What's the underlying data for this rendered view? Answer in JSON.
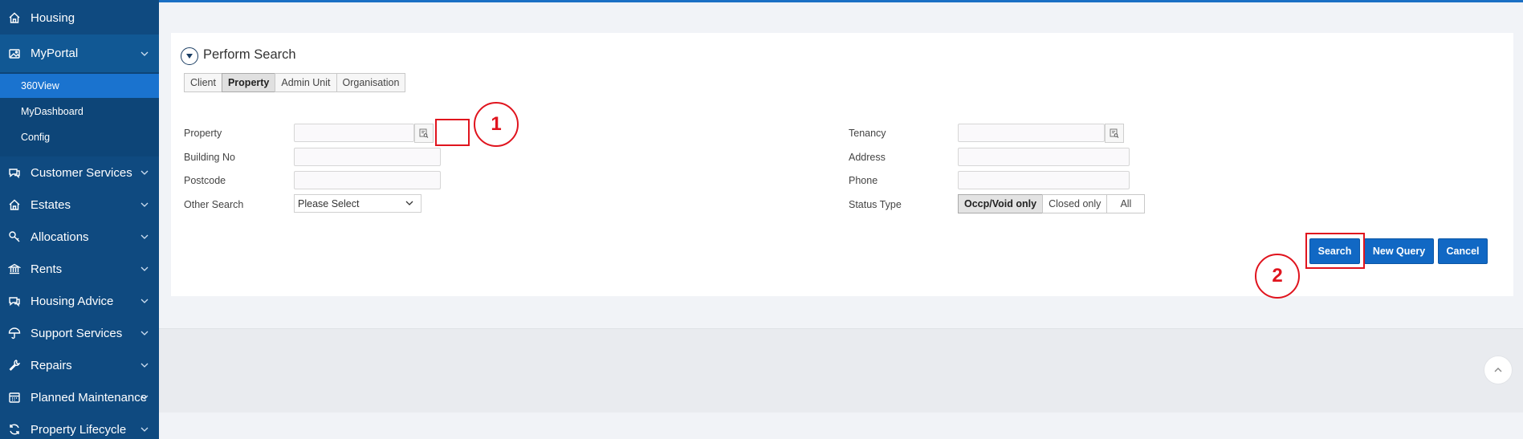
{
  "sidebar": {
    "items": [
      {
        "label": "Housing",
        "icon": "home-icon"
      },
      {
        "label": "MyPortal",
        "icon": "image-icon"
      },
      {
        "label": "Customer Services",
        "icon": "chat-icon"
      },
      {
        "label": "Estates",
        "icon": "home-icon"
      },
      {
        "label": "Allocations",
        "icon": "key-icon"
      },
      {
        "label": "Rents",
        "icon": "bank-icon"
      },
      {
        "label": "Housing Advice",
        "icon": "chat-icon"
      },
      {
        "label": "Support Services",
        "icon": "umbrella-icon"
      },
      {
        "label": "Repairs",
        "icon": "wrench-icon"
      },
      {
        "label": "Planned Maintenance",
        "icon": "calendar-icon"
      },
      {
        "label": "Property Lifecycle",
        "icon": "refresh-icon"
      }
    ],
    "subitems": [
      {
        "label": "360View",
        "active": true
      },
      {
        "label": "MyDashboard",
        "active": false
      },
      {
        "label": "Config",
        "active": false
      }
    ]
  },
  "search": {
    "title": "Perform Search",
    "tabs": [
      {
        "label": "Client",
        "active": false
      },
      {
        "label": "Property",
        "active": true
      },
      {
        "label": "Admin Unit",
        "active": false
      },
      {
        "label": "Organisation",
        "active": false
      }
    ],
    "left_fields": {
      "property_label": "Property",
      "property_value": "",
      "building_no_label": "Building No",
      "building_no_value": "",
      "postcode_label": "Postcode",
      "postcode_value": "",
      "other_search_label": "Other Search",
      "other_search_value": "Please Select"
    },
    "right_fields": {
      "tenancy_label": "Tenancy",
      "tenancy_value": "",
      "address_label": "Address",
      "address_value": "",
      "phone_label": "Phone",
      "phone_value": "",
      "status_type_label": "Status Type",
      "status_options": [
        {
          "label": "Occp/Void only",
          "active": true
        },
        {
          "label": "Closed only",
          "active": false
        },
        {
          "label": "All",
          "active": false
        }
      ]
    },
    "buttons": {
      "search": "Search",
      "new_query": "New Query",
      "cancel": "Cancel"
    }
  },
  "annotations": {
    "marker_1": "1",
    "marker_2": "2"
  },
  "colors": {
    "sidebar_bg": "#0f4a80",
    "accent": "#1a73cf",
    "button": "#1168c4",
    "highlight": "#e0141e"
  }
}
